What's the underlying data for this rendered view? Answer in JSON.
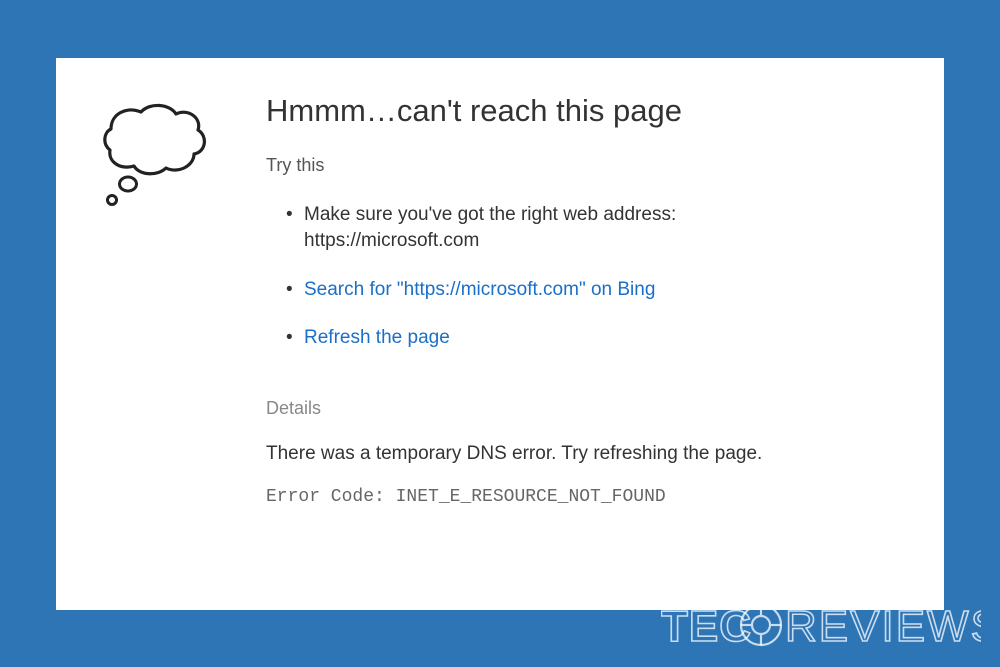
{
  "header": {
    "title": "Hmmm…can't reach this page",
    "try_this_label": "Try this"
  },
  "suggestions": {
    "check_address_line1": "Make sure you've got the right web address:",
    "check_address_line2": "https://microsoft.com",
    "search_bing_label": "Search for \"https://microsoft.com\" on Bing",
    "refresh_label": "Refresh the page"
  },
  "details": {
    "section_label": "Details",
    "message": "There was a temporary DNS error. Try refreshing the page.",
    "error_code_prefix": "Error Code: ",
    "error_code_value": "INET_E_RESOURCE_NOT_FOUND"
  },
  "watermark": {
    "text": "TECOREVIEWS"
  }
}
